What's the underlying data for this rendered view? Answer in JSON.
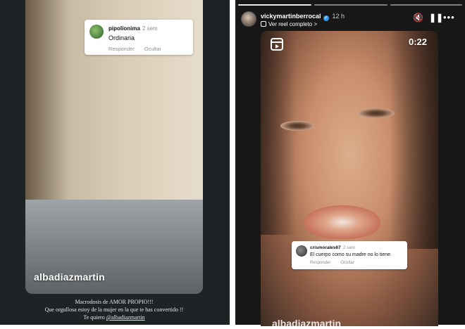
{
  "left_story": {
    "comment": {
      "username": "pipolionima",
      "time": "2 sem",
      "text": "Ordinaria",
      "reply_label": "Responder",
      "hide_label": "Ocultar"
    },
    "tag": "albadiazmartin",
    "caption": {
      "line1": "Macrodosis de AMOR PROPIO!!!",
      "line2": "Que orgullosa estoy de la mujer en la que te has convertido !!",
      "line3_prefix": "Te quiero ",
      "line3_mention": "@albadiazmartin"
    }
  },
  "right_story": {
    "header": {
      "username": "vickymartinberrocal",
      "verified_glyph": "✓",
      "time": "12 h",
      "sub_label": "Ver reel completo",
      "sub_arrow": ">"
    },
    "icons": {
      "mute": "mute-icon",
      "pause": "pause-icon",
      "more": "more-icon",
      "reel": "reel-icon"
    },
    "icon_glyphs": {
      "mute": "🔇",
      "pause": "❚❚",
      "more": "•••"
    },
    "timer": "0:22",
    "comment": {
      "username": "crismorales67",
      "time": "2 sem",
      "text": "El cuerpo como su madre no lo tiene",
      "reply_label": "Responder",
      "hide_label": "Ocultar"
    },
    "tag": "albadiazmartin"
  },
  "colors": {
    "verified": "#3897f0",
    "background_dark": "#171717"
  }
}
